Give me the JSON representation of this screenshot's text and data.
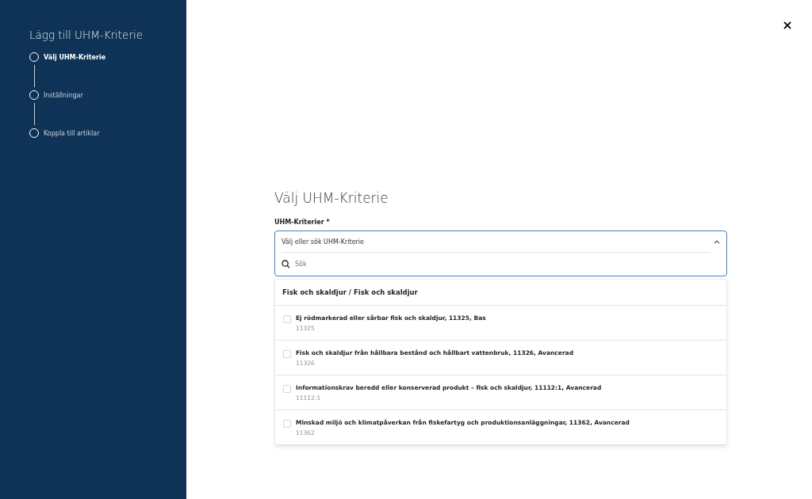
{
  "sidebar": {
    "title": "Lägg till UHM-Kriterie",
    "steps": [
      {
        "label": "Välj UHM-Kriterie",
        "selected": true
      },
      {
        "label": "Inställningar",
        "selected": false
      },
      {
        "label": "Koppla till artiklar",
        "selected": false
      }
    ]
  },
  "main": {
    "title": "Välj UHM-Kriterie",
    "field_label": "UHM-Kriterier *",
    "select": {
      "placeholder": "Välj eller sök UHM-Kriterie",
      "expanded": true
    },
    "search": {
      "placeholder": "Sök"
    },
    "dropdown": {
      "group": "Fisk och skaldjur / Fisk och skaldjur",
      "options": [
        {
          "label": "Ej rödmarkerad eller sårbar fisk och skaldjur, 11325, Bas",
          "code": "11325",
          "checked": false
        },
        {
          "label": "Fisk och skaldjur från hållbara bestånd och hållbart vattenbruk, 11326, Avancerad",
          "code": "11326",
          "checked": false
        },
        {
          "label": "Informationskrav beredd eller konserverad produkt – fisk och skaldjur, 11112:1, Avancerad",
          "code": "11112:1",
          "checked": false
        },
        {
          "label": "Minskad miljö och klimatpåverkan från fiskefartyg och produktionsanläggningar, 11362, Avancerad",
          "code": "11362",
          "checked": false
        }
      ]
    }
  }
}
